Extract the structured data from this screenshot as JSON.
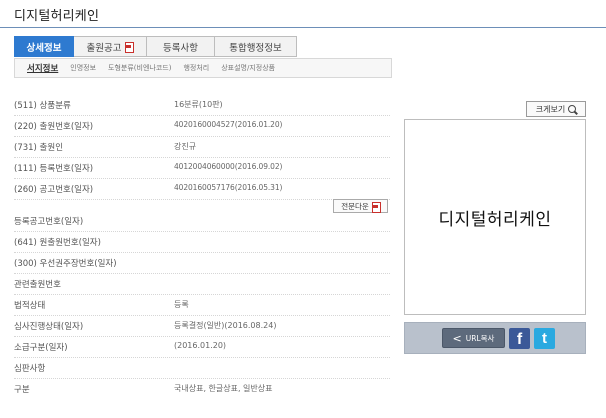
{
  "page_title": "디지털허리케인",
  "tabs": [
    {
      "label": "상세정보",
      "active": true
    },
    {
      "label": "출원공고",
      "pdf": true
    },
    {
      "label": "등록사항"
    },
    {
      "label": "통합행정정보"
    }
  ],
  "subnav": [
    "서지정보",
    "인명정보",
    "도형분류(비엔나코드)",
    "행정처리",
    "상표설명/지정상품"
  ],
  "rows": [
    {
      "label": "(511) 상품분류",
      "value": "16분류(10판)"
    },
    {
      "label": "(220) 출원번호(일자)",
      "value": "4020160004527(2016.01.20)"
    },
    {
      "label": "(731) 출원인",
      "value": "강진규"
    },
    {
      "label": "(111) 등록번호(일자)",
      "value": "4012004060000(2016.09.02)"
    },
    {
      "label": "(260) 공고번호(일자)",
      "value": "4020160057176(2016.05.31)"
    },
    {
      "label": "등록공고번호(일자)",
      "value": ""
    },
    {
      "label": "(641) 원출원번호(일자)",
      "value": ""
    },
    {
      "label": "(300) 우선권주장번호(일자)",
      "value": ""
    },
    {
      "label": "관련출원번호",
      "value": ""
    },
    {
      "label": "법적상태",
      "value": "등록"
    },
    {
      "label": "심사진행상태(일자)",
      "value": "등록결정(일반)(2016.08.24)"
    },
    {
      "label": "소급구분(일자)",
      "value": "(2016.01.20)"
    },
    {
      "label": "심판사항",
      "value": ""
    },
    {
      "label": "구분",
      "value": "국내상표, 한글상표, 일반상표"
    }
  ],
  "fulltext_label": "전문다운",
  "zoom_label": "크게보기",
  "mark_text": "디지털허리케인",
  "url_copy_label": "URL복사",
  "facebook_glyph": "f",
  "twitter_glyph": "t",
  "colors": {
    "accent": "#2e7ad0",
    "facebook": "#3b5998",
    "twitter": "#2aa9e0"
  }
}
